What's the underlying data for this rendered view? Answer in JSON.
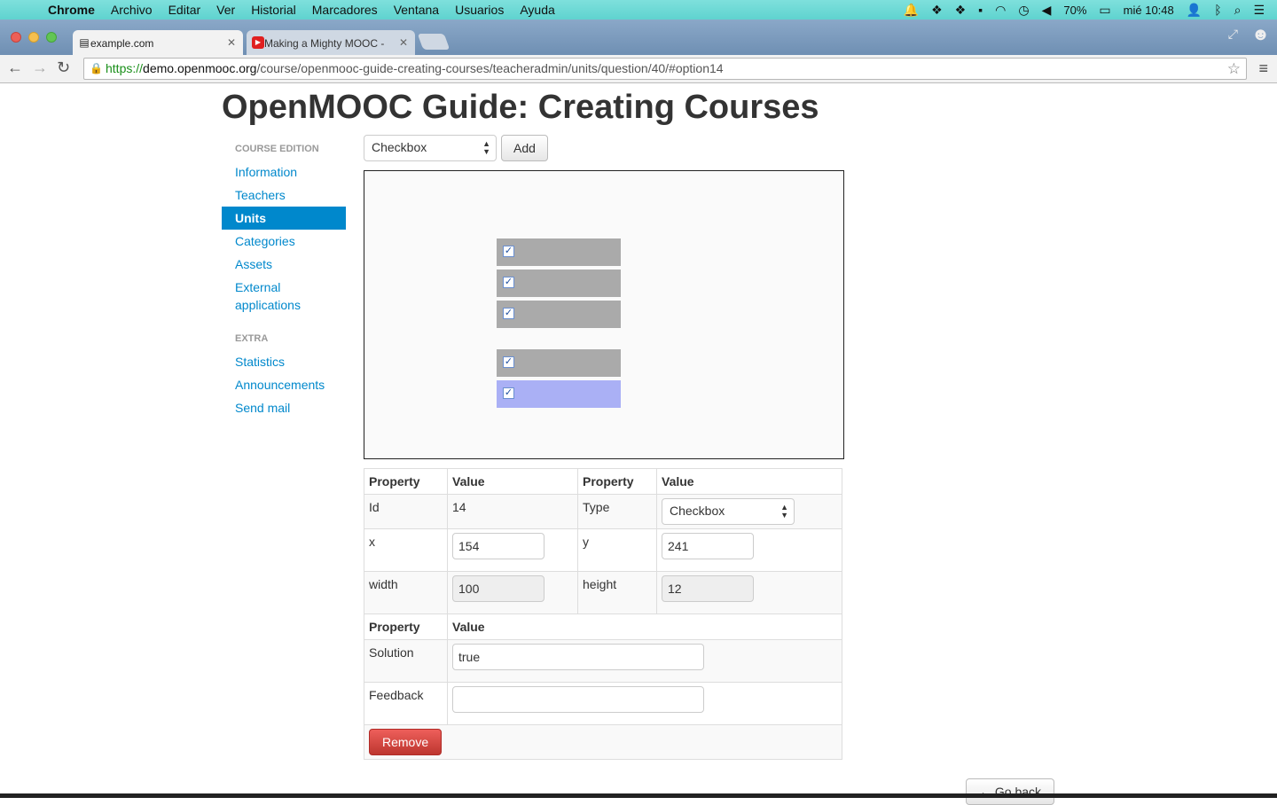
{
  "menubar": {
    "app": "Chrome",
    "items": [
      "Archivo",
      "Editar",
      "Ver",
      "Historial",
      "Marcadores",
      "Ventana",
      "Usuarios",
      "Ayuda"
    ],
    "battery": "70%",
    "clock": "mié 10:48"
  },
  "tabs": [
    {
      "title": "example.com",
      "favicon": "page-icon"
    },
    {
      "title": "Making a Mighty MOOC - ",
      "favicon": "youtube-icon"
    }
  ],
  "toolbar": {
    "url_scheme": "https://",
    "url_host": "demo.openmooc.org",
    "url_path": "/course/openmooc-guide-creating-courses/teacheradmin/units/question/40/#option14"
  },
  "page": {
    "title": "OpenMOOC Guide: Creating Courses"
  },
  "sidebar": {
    "section1": "COURSE EDITION",
    "items1": [
      {
        "label": "Information",
        "active": false
      },
      {
        "label": "Teachers",
        "active": false
      },
      {
        "label": "Units",
        "active": true
      },
      {
        "label": "Categories",
        "active": false
      },
      {
        "label": "Assets",
        "active": false
      },
      {
        "label": "External applications",
        "active": false
      }
    ],
    "section2": "EXTRA",
    "items2": [
      {
        "label": "Statistics"
      },
      {
        "label": "Announcements"
      },
      {
        "label": "Send mail"
      }
    ]
  },
  "controls": {
    "type_select": "Checkbox",
    "add_label": "Add"
  },
  "properties": {
    "header_property": "Property",
    "header_value": "Value",
    "id_label": "Id",
    "id_value": "14",
    "type_label": "Type",
    "type_value": "Checkbox",
    "x_label": "x",
    "x_value": "154",
    "y_label": "y",
    "y_value": "241",
    "width_label": "width",
    "width_value": "100",
    "height_label": "height",
    "height_value": "12",
    "solution_label": "Solution",
    "solution_value": "true",
    "feedback_label": "Feedback",
    "feedback_value": "",
    "remove_label": "Remove"
  },
  "go_back_label": "Go back"
}
